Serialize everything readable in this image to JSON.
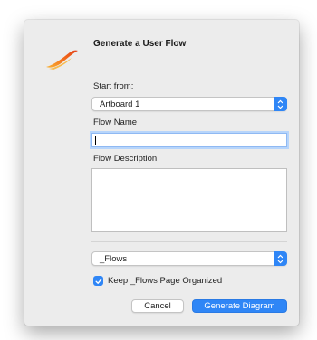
{
  "dialog": {
    "title": "Generate a User Flow",
    "logo_icon": "brush-stroke-logo"
  },
  "start_from": {
    "label": "Start from:",
    "selected": "Artboard 1"
  },
  "flow_name": {
    "label": "Flow Name",
    "value": "",
    "focused": true
  },
  "flow_description": {
    "label": "Flow Description",
    "value": ""
  },
  "page_select": {
    "selected": "_Flows"
  },
  "keep_organized": {
    "label": "Keep _Flows Page Organized",
    "checked": true
  },
  "buttons": {
    "cancel": "Cancel",
    "generate": "Generate Diagram"
  },
  "colors": {
    "accent": "#2f86f6",
    "dialog_bg": "#ececec",
    "logo_orange": "#f26a1b",
    "logo_yellow": "#f9b233"
  }
}
